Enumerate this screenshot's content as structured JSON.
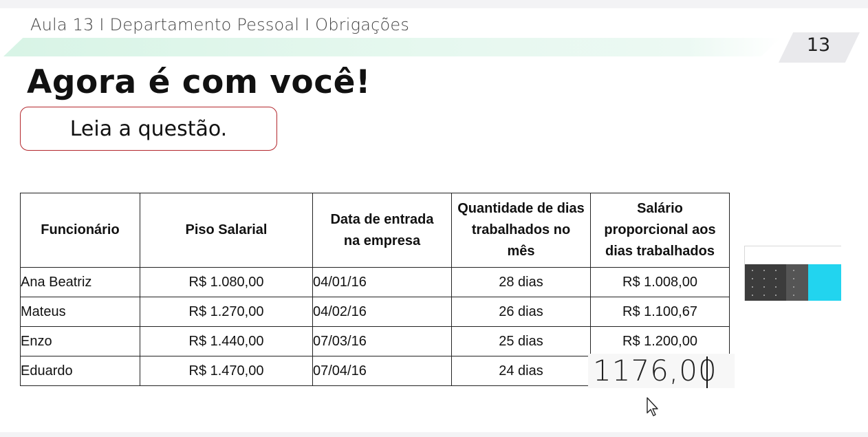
{
  "header": {
    "course_title": "Aula 13 I Departamento Pessoal I Obrigações",
    "page_number": "13"
  },
  "main": {
    "title": "Agora é com você!",
    "instruction": "Leia a questão."
  },
  "table": {
    "headers": [
      "Funcionário",
      "Piso Salarial",
      "Data de entrada na empresa",
      "Quantidade de dias trabalhados no mês",
      "Salário proporcional aos dias trabalhados"
    ],
    "rows": [
      [
        "Ana Beatriz",
        "R$ 1.080,00",
        "04/01/16",
        "28 dias",
        "R$ 1.008,00"
      ],
      [
        "Mateus",
        "R$ 1.270,00",
        "04/02/16",
        "26 dias",
        "R$ 1.100,67"
      ],
      [
        "Enzo",
        "R$ 1.440,00",
        "07/03/16",
        "25 dias",
        "R$ 1.200,00"
      ],
      [
        "Eduardo",
        "R$ 1.470,00",
        "07/04/16",
        "24 dias",
        ""
      ]
    ]
  },
  "answer_input": {
    "value": "1176,00"
  },
  "icons": {
    "calculator": "calculator-icon",
    "cursor": "mouse-pointer-icon"
  },
  "colors": {
    "accent_border": "#b3262c",
    "band": "#d8f4e6",
    "calculator_accent": "#22d4ef"
  }
}
